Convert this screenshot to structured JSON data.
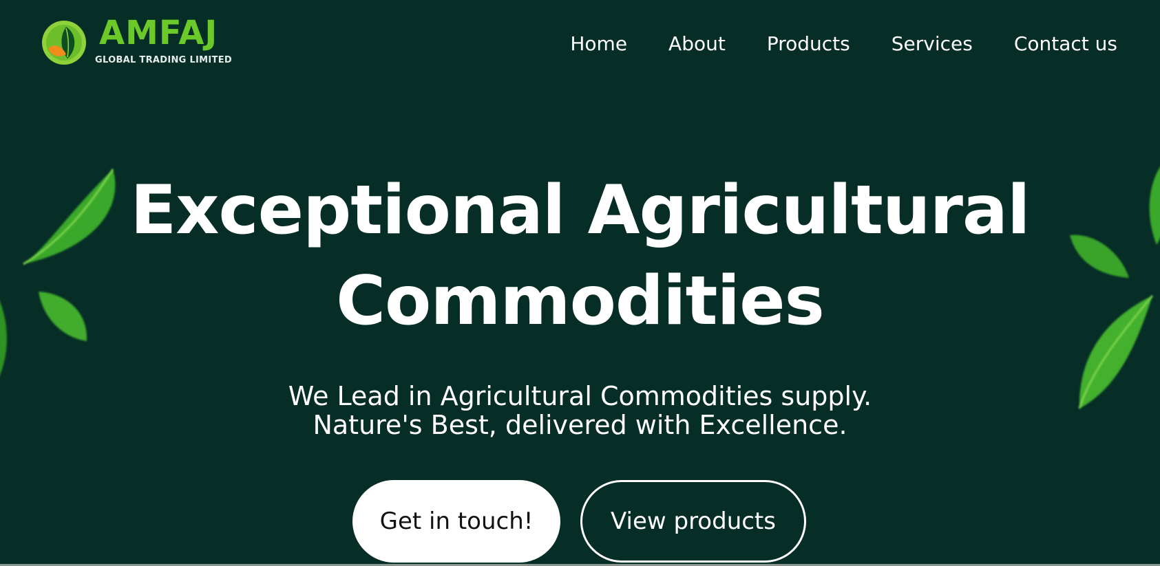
{
  "brand": {
    "name": "AMFAJ",
    "tagline": "GLOBAL TRADING LIMITED",
    "colors": {
      "logo_green": "#6cc92a",
      "logo_orange": "#f28a1c",
      "background": "#062e26"
    }
  },
  "nav": {
    "items": [
      {
        "label": "Home"
      },
      {
        "label": "About"
      },
      {
        "label": "Products"
      },
      {
        "label": "Services"
      },
      {
        "label": "Contact us"
      }
    ]
  },
  "hero": {
    "title_line1": "Exceptional Agricultural",
    "title_line2": "Commodities",
    "subtitle_line1": "We Lead in Agricultural Commodities supply.",
    "subtitle_line2": "Nature's Best, delivered with Excellence.",
    "primary_button": "Get in touch!",
    "secondary_button": "View products"
  },
  "decor": {
    "icon": "leaf-icon"
  }
}
